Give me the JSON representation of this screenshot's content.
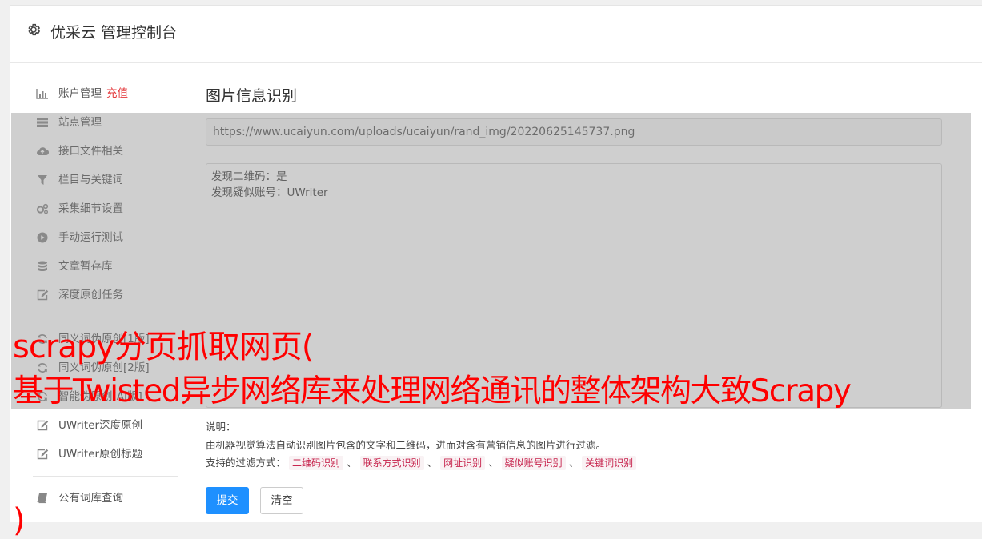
{
  "header": {
    "title": "优采云 管理控制台",
    "icon": "gear-icon"
  },
  "sidebar": {
    "items": [
      {
        "label": "账户管理",
        "badge": "充值",
        "icon": "bar-chart-icon"
      },
      {
        "label": "站点管理",
        "icon": "server-icon"
      },
      {
        "label": "接口文件相关",
        "icon": "cloud-upload-icon"
      },
      {
        "label": "栏目与关键词",
        "icon": "filter-icon"
      },
      {
        "label": "采集细节设置",
        "icon": "cogs-icon"
      },
      {
        "label": "手动运行测试",
        "icon": "play-circle-icon"
      },
      {
        "label": "文章暂存库",
        "icon": "database-icon"
      },
      {
        "label": "深度原创任务",
        "icon": "edit-icon"
      },
      {
        "label": "同义词伪原创[1版]",
        "icon": "refresh-icon"
      },
      {
        "label": "同义词伪原创[2版]",
        "icon": "refresh-icon"
      },
      {
        "label": "智能伪原创[AI版]",
        "icon": "refresh-icon"
      },
      {
        "label": "UWriter深度原创",
        "icon": "edit-icon"
      },
      {
        "label": "UWriter原创标题",
        "icon": "edit-icon"
      },
      {
        "label": "公有词库查询",
        "icon": "book-icon"
      }
    ]
  },
  "main": {
    "title": "图片信息识别",
    "url_value": "https://www.ucaiyun.com/uploads/ucaiyun/rand_img/20220625145737.png",
    "result_lines": [
      "发现二维码：是",
      "发现疑似账号：UWriter"
    ],
    "help": {
      "label": "说明：",
      "description": "由机器视觉算法自动识别图片包含的文字和二维码，进而对含有营销信息的图片进行过滤。",
      "filter_prefix": "支持的过滤方式：",
      "tags": [
        "二维码识别",
        "联系方式识别",
        "网址识别",
        "疑似账号识别",
        "关键词识别"
      ],
      "separator": "、"
    },
    "submit_label": "提交",
    "clear_label": "清空"
  },
  "overlay": {
    "line1": "scrapy分页抓取网页(",
    "line2": "基于Twisted异步网络库来处理网络通讯的整体架构大致Scrapy",
    "line3": ")"
  },
  "colors": {
    "accent": "#1e90ff",
    "recharge": "#e4393c",
    "banner": "#ff0000",
    "tag_text": "#c7254e",
    "tag_bg": "#f9f2f4"
  }
}
